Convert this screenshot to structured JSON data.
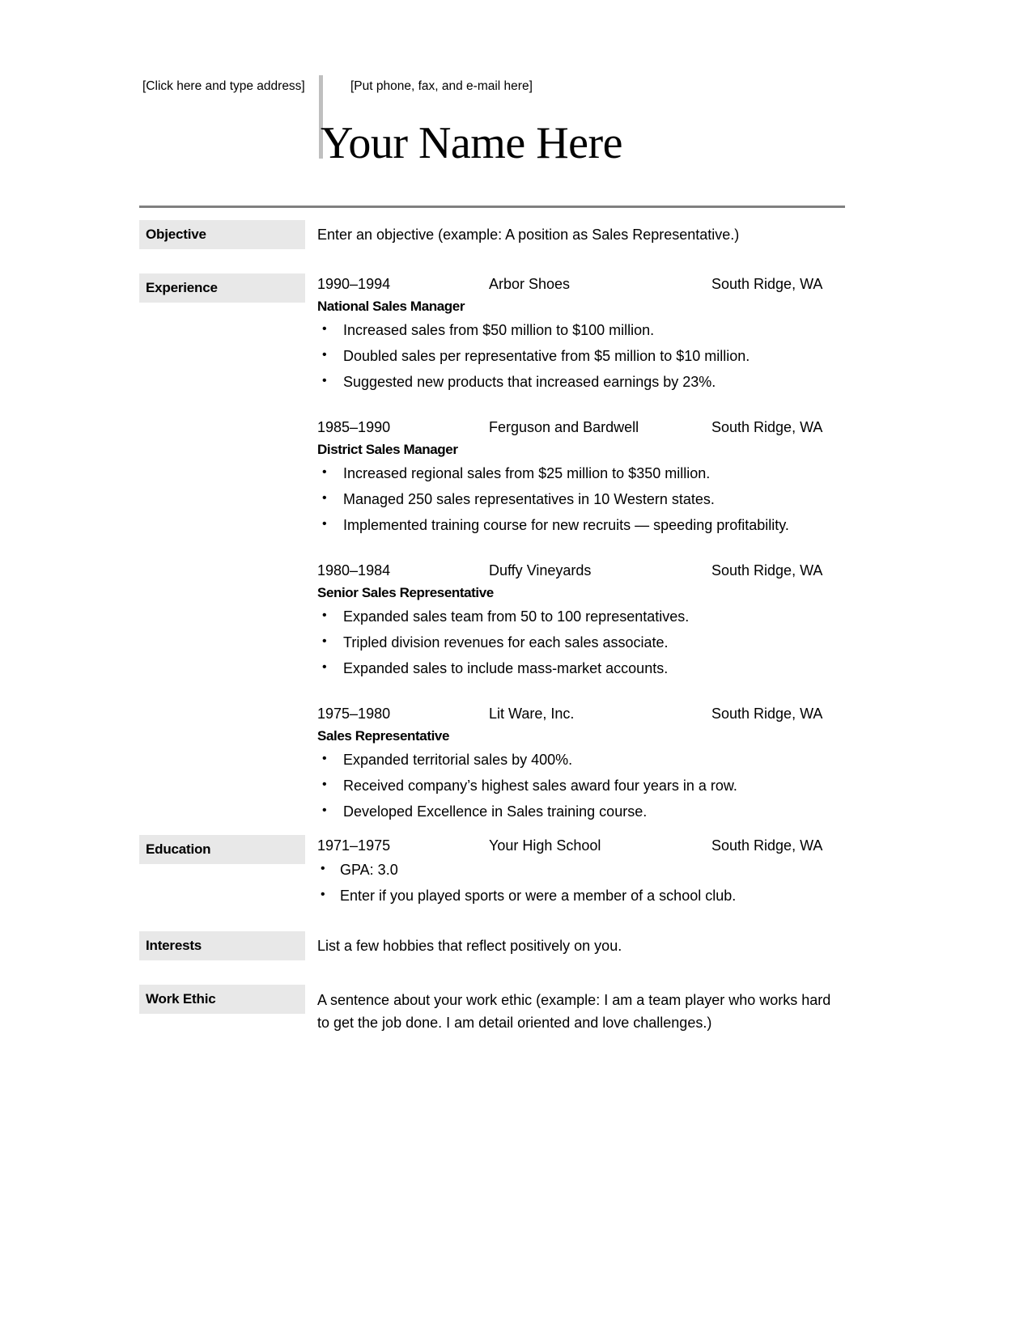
{
  "header": {
    "address_placeholder": "[Click here and type address]",
    "contact_placeholder": "[Put phone, fax, and e-mail here]",
    "name": "Your Name Here"
  },
  "sections": {
    "objective": {
      "label": "Objective",
      "text": "Enter an objective (example: A position as Sales Representative.)"
    },
    "experience": {
      "label": "Experience",
      "jobs": [
        {
          "years": "1990–1994",
          "company": "Arbor Shoes",
          "location": "South Ridge, WA",
          "title": "National Sales Manager",
          "bullets": [
            "Increased sales from $50 million to $100 million.",
            "Doubled sales per representative from $5 million to $10 million.",
            "Suggested new products that increased earnings by 23%."
          ]
        },
        {
          "years": "1985–1990",
          "company": "Ferguson and Bardwell",
          "location": "South Ridge, WA",
          "title": "District Sales Manager",
          "bullets": [
            "Increased regional sales from $25 million to $350 million.",
            "Managed 250 sales representatives in 10 Western states.",
            "Implemented training course for new recruits — speeding profitability."
          ]
        },
        {
          "years": "1980–1984",
          "company": "Duffy Vineyards",
          "location": "South Ridge, WA",
          "title": "Senior Sales Representative",
          "bullets": [
            "Expanded sales team from 50 to 100 representatives.",
            "Tripled division revenues for each sales associate.",
            "Expanded sales to include mass-market accounts."
          ]
        },
        {
          "years": "1975–1980",
          "company": "Lit Ware, Inc.",
          "location": "South Ridge, WA",
          "title": "Sales Representative",
          "bullets": [
            "Expanded territorial sales by 400%.",
            "Received company’s highest sales award four years in a row.",
            "Developed Excellence in Sales training course."
          ]
        }
      ]
    },
    "education": {
      "label": "Education",
      "years": "1971–1975",
      "school": "Your High School",
      "location": "South Ridge, WA",
      "bullets": [
        "GPA: 3.0",
        "Enter if you played sports or were a member of a school club."
      ]
    },
    "interests": {
      "label": "Interests",
      "text": "List a few hobbies that reflect positively on you."
    },
    "work_ethic": {
      "label": "Work Ethic",
      "text": "A sentence about your work ethic (example: I am a team player who works hard to get the job done. I am detail oriented and love challenges.)"
    }
  },
  "colors": {
    "label_background": "#e8e8e8",
    "rule": "#808080",
    "vertical_rule": "#bfbfbf",
    "text": "#000000",
    "page": "#ffffff"
  }
}
